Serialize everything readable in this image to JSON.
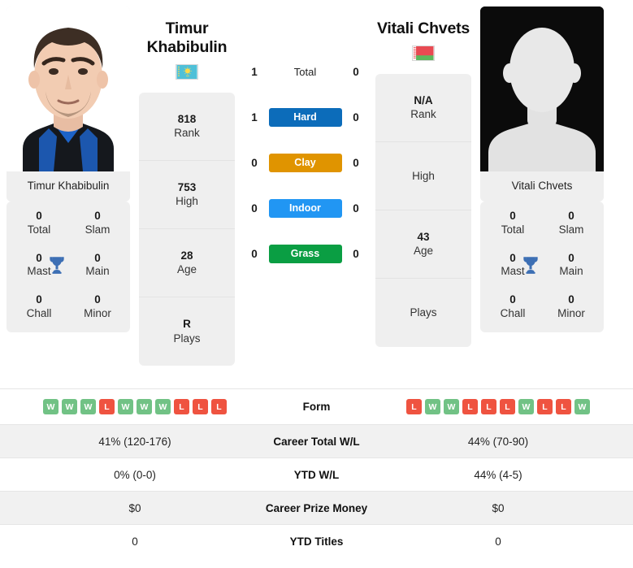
{
  "players": {
    "left": {
      "name_line1": "Timur",
      "name_line2": "Khabibulin",
      "photo_caption": "Timur Khabibulin",
      "flag_name": "kazakhstan-flag",
      "stats": [
        {
          "value": "818",
          "label": "Rank"
        },
        {
          "value": "753",
          "label": "High"
        },
        {
          "value": "28",
          "label": "Age"
        },
        {
          "value": "R",
          "label": "Plays"
        }
      ],
      "titles": {
        "header": "Timur Khabibulin",
        "cells": [
          {
            "value": "0",
            "label": "Total"
          },
          {
            "value": "0",
            "label": "Slam"
          },
          {
            "value": "0",
            "label": "Mast"
          },
          {
            "value": "0",
            "label": "Main"
          },
          {
            "value": "0",
            "label": "Chall"
          },
          {
            "value": "0",
            "label": "Minor"
          }
        ]
      },
      "form": [
        "W",
        "W",
        "W",
        "L",
        "W",
        "W",
        "W",
        "L",
        "L",
        "L"
      ],
      "career_total_wl": "41% (120-176)",
      "ytd_wl": "0% (0-0)",
      "career_prize_money": "$0",
      "ytd_titles": "0"
    },
    "right": {
      "name_line1": "Vitali Chvets",
      "name_line2": "",
      "photo_caption": "Vitali Chvets",
      "flag_name": "belarus-flag",
      "stats": [
        {
          "value": "N/A",
          "label": "Rank"
        },
        {
          "value": "",
          "label": "High"
        },
        {
          "value": "43",
          "label": "Age"
        },
        {
          "value": "",
          "label": "Plays"
        }
      ],
      "titles": {
        "header": "Vitali Chvets",
        "cells": [
          {
            "value": "0",
            "label": "Total"
          },
          {
            "value": "0",
            "label": "Slam"
          },
          {
            "value": "0",
            "label": "Mast"
          },
          {
            "value": "0",
            "label": "Main"
          },
          {
            "value": "0",
            "label": "Chall"
          },
          {
            "value": "0",
            "label": "Minor"
          }
        ]
      },
      "form": [
        "L",
        "W",
        "W",
        "L",
        "L",
        "L",
        "W",
        "L",
        "L",
        "W"
      ],
      "career_total_wl": "44% (70-90)",
      "ytd_wl": "44% (4-5)",
      "career_prize_money": "$0",
      "ytd_titles": "0"
    }
  },
  "surfaces": [
    {
      "label": "Total",
      "left": "1",
      "right": "0",
      "color": "transparent",
      "plain": true
    },
    {
      "label": "Hard",
      "left": "1",
      "right": "0",
      "color": "#0c6cba",
      "plain": false
    },
    {
      "label": "Clay",
      "left": "0",
      "right": "0",
      "color": "#e09400",
      "plain": false
    },
    {
      "label": "Indoor",
      "left": "0",
      "right": "0",
      "color": "#2196f3",
      "plain": false
    },
    {
      "label": "Grass",
      "left": "0",
      "right": "0",
      "color": "#0a9e43",
      "plain": false
    }
  ],
  "table": {
    "rows": [
      {
        "label": "Form",
        "left": "",
        "right": "",
        "kind": "form"
      },
      {
        "label": "Career Total W/L",
        "left": "41% (120-176)",
        "right": "44% (70-90)",
        "kind": "text"
      },
      {
        "label": "YTD W/L",
        "left": "0% (0-0)",
        "right": "44% (4-5)",
        "kind": "text"
      },
      {
        "label": "Career Prize Money",
        "left": "$0",
        "right": "$0",
        "kind": "text"
      },
      {
        "label": "YTD Titles",
        "left": "0",
        "right": "0",
        "kind": "text"
      }
    ]
  },
  "colors": {
    "win": "#71c285",
    "loss": "#ef5340",
    "trophy": "#3d6fb4",
    "hard": "#0c6cba",
    "clay": "#e09400",
    "indoor": "#2196f3",
    "grass": "#0a9e43",
    "card_bg": "#efefef"
  },
  "icons": {
    "trophy": "trophy-icon",
    "left_avatar": "player-photo",
    "right_avatar": "player-photo-placeholder"
  }
}
